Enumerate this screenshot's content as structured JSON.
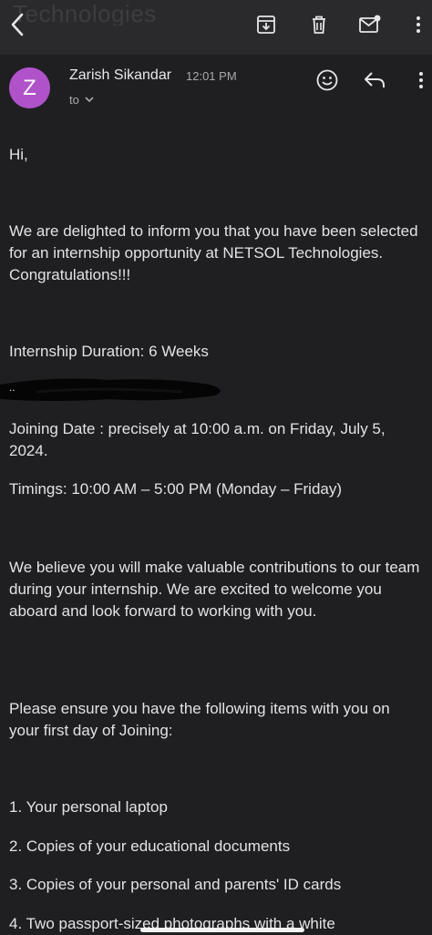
{
  "topbar": {
    "ghost_title": "Technologies",
    "icons": [
      "back-chevron-icon",
      "archive-icon",
      "trash-icon",
      "mark-unread-icon",
      "more-icon"
    ]
  },
  "sender": {
    "avatar_letter": "Z",
    "avatar_color": "#b052c9",
    "name": "Zarish Sikandar",
    "time": "12:01 PM",
    "to_label": "to"
  },
  "body": {
    "greeting": "Hi,",
    "intro": "We are delighted to inform you that you have been selected for an internship opportunity at NETSOL Technologies. Congratulations!!!",
    "duration": "Internship Duration: 6 Weeks",
    "redacted_dots": "..",
    "joining": "Joining Date : precisely at 10:00 a.m. on Friday, July 5, 2024.",
    "timings": "Timings: 10:00 AM – 5:00 PM (Monday – Friday)",
    "believe": "We believe you will make valuable contributions to our team during your internship. We are excited to welcome you aboard and look forward to working with you.",
    "ensure": "Please ensure you have the following items with you on your first day of Joining:",
    "items": [
      "1. Your personal laptop",
      "2. Copies of your educational documents",
      "3. Copies of your personal and parents' ID cards",
      "4. Two passport-sized photographs with a white"
    ]
  },
  "colors": {
    "background": "#1f1f21",
    "topbar": "#2a2a2c",
    "text": "#e3e3e6",
    "muted": "#a9a9ad"
  }
}
